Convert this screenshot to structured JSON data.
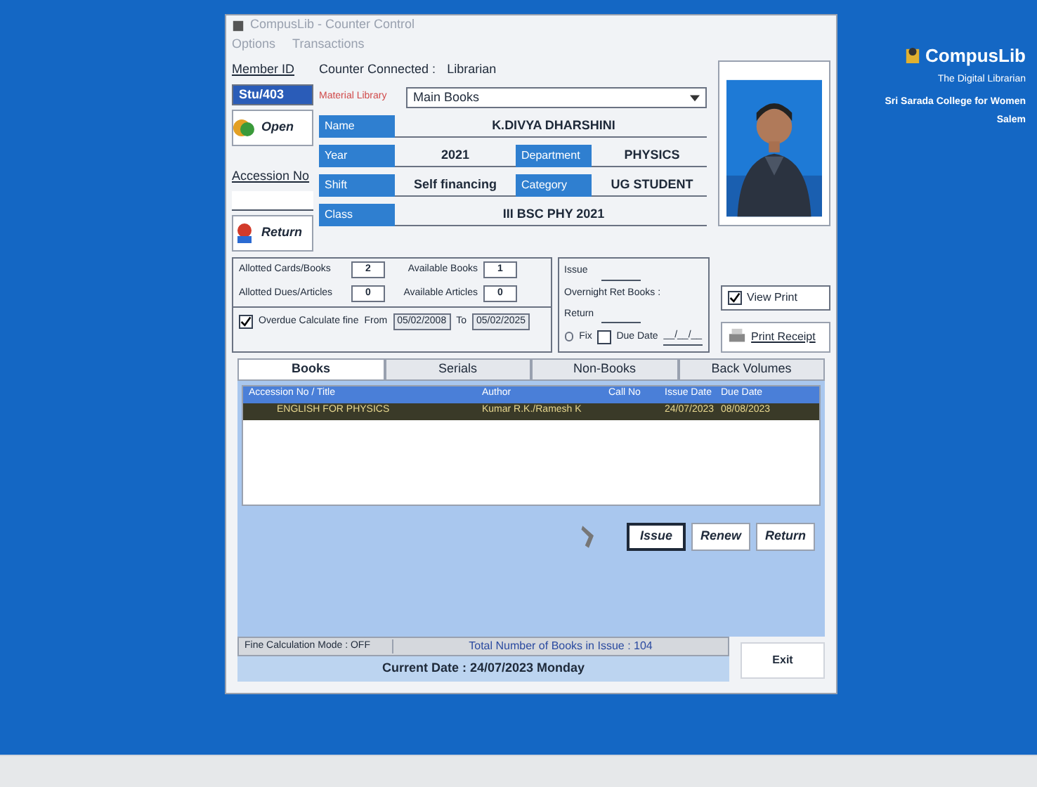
{
  "window": {
    "title": "CompusLib - Counter Control"
  },
  "menu": [
    "Options",
    "Transactions"
  ],
  "member": {
    "label": "Member ID",
    "value": "Stu/403",
    "open_button": "Open"
  },
  "accession": {
    "label": "Accession No",
    "return_button": "Return"
  },
  "counter": {
    "label": "Counter Connected :",
    "value": "Librarian"
  },
  "material": {
    "label": "Material Library",
    "value": "Main Books"
  },
  "details": [
    {
      "label": "Name",
      "value": "K.DIVYA DHARSHINI"
    },
    {
      "label": "Year",
      "value": "2021",
      "label2": "Department",
      "value2": "PHYSICS"
    },
    {
      "label": "Shift",
      "value": "Self financing",
      "label2": "Category",
      "value2": "UG STUDENT"
    },
    {
      "label": "Class",
      "value": "III BSC PHY 2021"
    }
  ],
  "counts": [
    {
      "label": "Allotted Cards/Books",
      "value": "2",
      "label2": "Available Books",
      "value2": "1"
    },
    {
      "label": "Allotted Dues/Articles",
      "value": "0",
      "label2": "Available Articles",
      "value2": "0"
    }
  ],
  "fine_range": {
    "label": "Overdue Calculate fine",
    "checked": true,
    "from_label": "From",
    "from": "05/02/2008",
    "to_label": "To",
    "to": "05/02/2025"
  },
  "issue_panel": {
    "issue_label": "Issue",
    "return_label": "Return",
    "overnight_label": "Overnight Ret Books :",
    "fix_label": "Fix",
    "fix_selected": false,
    "due_label": "Due Date",
    "due_checked": false,
    "due_value": "__/__/__"
  },
  "view_print": {
    "label": "View Print",
    "checked": true
  },
  "print_receipt": "Print Receipt",
  "tabs": [
    {
      "label": "Books",
      "selected": true
    },
    {
      "label": "Serials",
      "selected": false
    },
    {
      "label": "Non-Books",
      "selected": false
    },
    {
      "label": "Back Volumes",
      "selected": false
    }
  ],
  "table": {
    "columns": [
      "Accession No / Title",
      "Author",
      "Call No",
      "Issue Date",
      "Due Date"
    ],
    "rows": [
      {
        "cells": [
          "ENGLISH FOR PHYSICS",
          "Kumar R.K./Ramesh K",
          "",
          "24/07/2023",
          "08/08/2023"
        ],
        "selected": true
      }
    ]
  },
  "actions": [
    "Issue",
    "Renew",
    "Return"
  ],
  "status": {
    "fine_mode": "Fine Calculation Mode : OFF",
    "total": "Total Number of Books in Issue : 104",
    "current_date": "Current Date : 24/07/2023 Monday",
    "exit": "Exit"
  },
  "branding": {
    "name": "CompusLib",
    "tagline": "The Digital Librarian",
    "college": "Sri Sarada College for Women",
    "place": "Salem"
  }
}
